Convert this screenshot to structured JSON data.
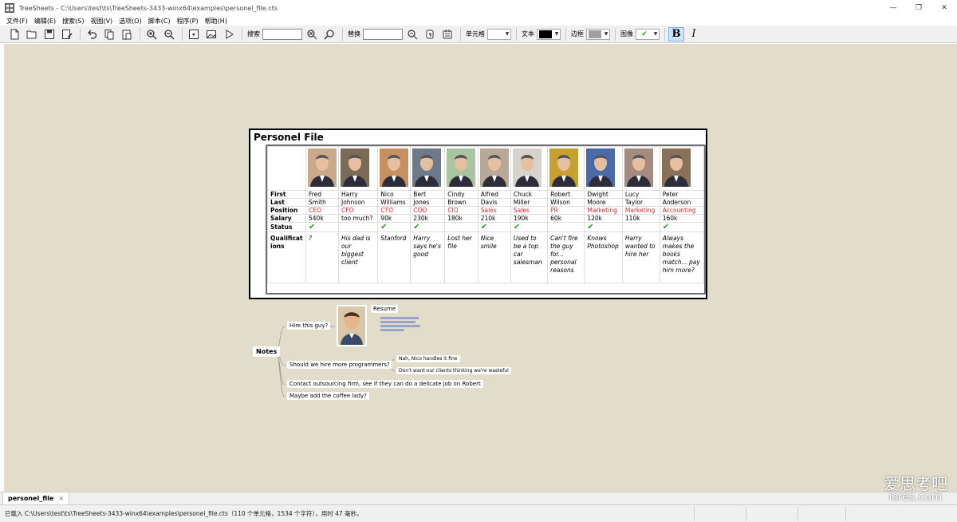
{
  "window": {
    "title": "TreeSheets - C:\\Users\\test\\ts\\TreeSheets-3433-winx64\\examples\\personel_file.cts",
    "controls": [
      "—",
      "❐",
      "✕"
    ]
  },
  "menu": [
    "文件(F)",
    "编辑(E)",
    "搜索(S)",
    "视图(V)",
    "选项(O)",
    "脚本(C)",
    "程序(P)",
    "帮助(H)"
  ],
  "toolbar": {
    "search_label": "搜索",
    "replace_label": "替换",
    "cell_label": "单元格",
    "text_label": "文本",
    "border_label": "边框",
    "image_label": "图像",
    "bold": "B",
    "italic": "I",
    "text_color": "#000000",
    "border_color": "#a0a0a0",
    "image_check": "✔"
  },
  "grid": {
    "title": "Personel File",
    "row_labels": [
      "First",
      "Last",
      "Position",
      "Salary",
      "Status",
      "Qualificat ions"
    ],
    "people": [
      {
        "first": "Fred",
        "last": "Smith",
        "position": "CEO",
        "salary": "540k",
        "status": true,
        "qual": "?",
        "photo_color": "#c9a98a"
      },
      {
        "first": "Harry",
        "last": "Johnson",
        "position": "CFO",
        "salary": "too much?",
        "status": false,
        "qual": "His dad is our biggest client",
        "photo_color": "#7b6a55"
      },
      {
        "first": "Nico",
        "last": "Williams",
        "position": "CTO",
        "salary": "90k",
        "status": true,
        "qual": "Stanford",
        "photo_color": "#c89060"
      },
      {
        "first": "Bert",
        "last": "Jones",
        "position": "COO",
        "salary": "230k",
        "status": true,
        "qual": "Harry says he's good",
        "photo_color": "#6e7a8a"
      },
      {
        "first": "Cindy",
        "last": "Brown",
        "position": "CIO",
        "salary": "180k",
        "status": false,
        "qual": "Lost her file",
        "photo_color": "#a9c4a0"
      },
      {
        "first": "Alfred",
        "last": "Davis",
        "position": "Sales",
        "salary": "210k",
        "status": true,
        "qual": "Nice smile",
        "photo_color": "#b8a898"
      },
      {
        "first": "Chuck",
        "last": "Miller",
        "position": "Sales",
        "salary": "190k",
        "status": true,
        "qual": "Used to be a top car salesman",
        "photo_color": "#d8d2cc"
      },
      {
        "first": "Robert",
        "last": "Wilson",
        "position": "PR",
        "salary": "60k",
        "status": false,
        "qual": "Can't fire the guy for... personal reasons",
        "photo_color": "#c8a030"
      },
      {
        "first": "Dwight",
        "last": "Moore",
        "position": "Marketing",
        "salary": "120k",
        "status": true,
        "qual": "Knows Photoshop",
        "photo_color": "#4a6aa8"
      },
      {
        "first": "Lucy",
        "last": "Taylor",
        "position": "Marketing",
        "salary": "110k",
        "status": false,
        "qual": "Harry wanted to hire her",
        "photo_color": "#a58a80"
      },
      {
        "first": "Peter",
        "last": "Anderson",
        "position": "Accounting",
        "salary": "160k",
        "status": true,
        "qual": "Always makes the books match... pay him more?",
        "photo_color": "#8a7058"
      }
    ],
    "check_glyph": "✔"
  },
  "notes": {
    "root": "Notes",
    "hire": "Hire this guy?",
    "resume": "Resume",
    "programmers": "Should we hire more programmers?",
    "nah": "Nah, Nico handles it fine",
    "wasteful": "Don't want our clients thinking we're wasteful",
    "outsourcing": "Contact outsourcing firm, see if they can do a delicate job on Robert",
    "coffee": "Maybe add the coffee lady?"
  },
  "tab": {
    "label": "personel_file",
    "close": "×"
  },
  "status": {
    "text": "已载入 C:\\Users\\test\\ts\\TreeSheets-3433-winx64\\examples\\personel_file.cts（110 个单元格，1534 个字符），用时 47 毫秒。"
  },
  "watermark": {
    "cn": "爱思考吧",
    "en": "isres.com"
  }
}
